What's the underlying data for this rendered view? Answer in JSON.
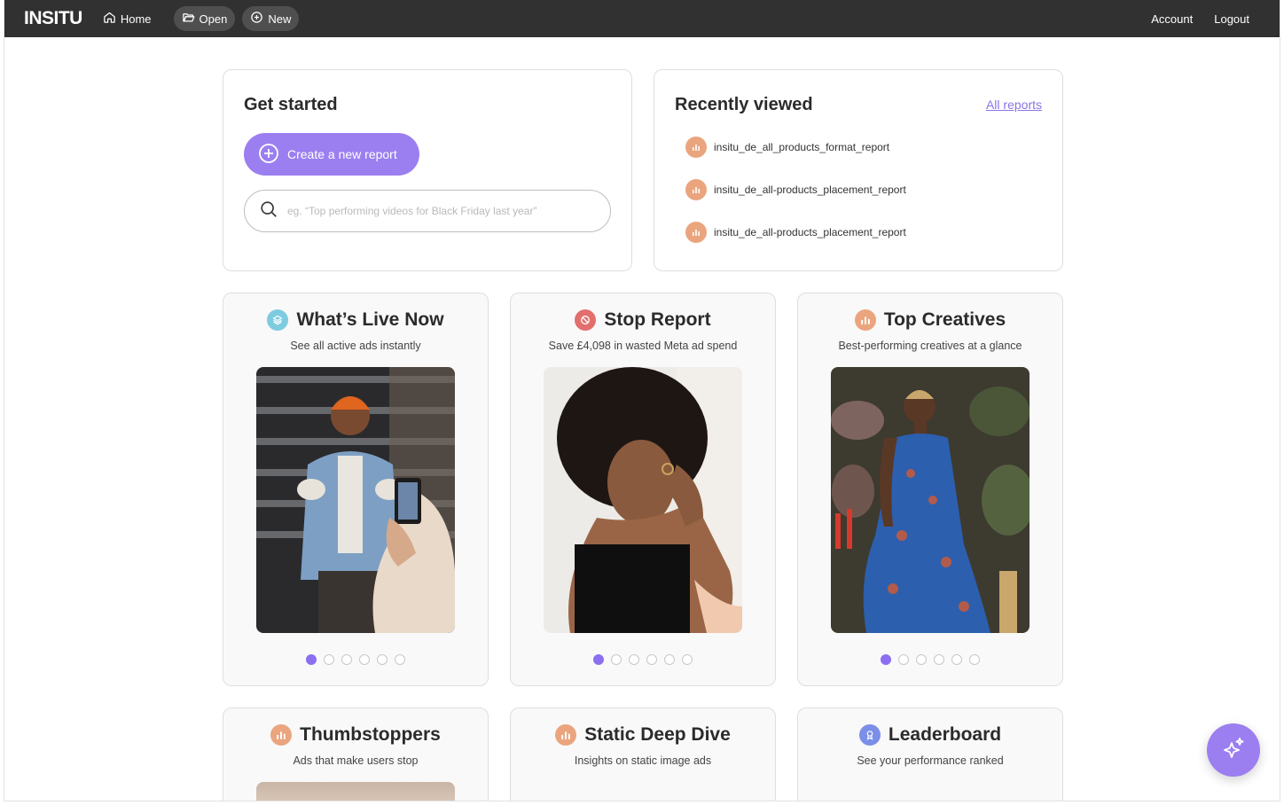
{
  "app": {
    "logo": "INSITU"
  },
  "nav": {
    "home": "Home",
    "open": "Open",
    "new": "New",
    "account": "Account",
    "logout": "Logout"
  },
  "get_started": {
    "title": "Get started",
    "create_label": "Create a new report",
    "search_placeholder": "eg. “Top performing videos for Black Friday last year”",
    "search_value": ""
  },
  "recent": {
    "title": "Recently viewed",
    "all_reports": "All reports",
    "items": [
      "insitu_de_all_products_format_report",
      "insitu_de_all-products_placement_report",
      "insitu_de_all-products_placement_report"
    ]
  },
  "cards": [
    {
      "title": "What’s Live Now",
      "subtitle": "See all active ads instantly",
      "icon": "layers-icon",
      "icon_color": "#7ecbe0",
      "slides": 6,
      "active_slide": 1
    },
    {
      "title": "Stop Report",
      "subtitle": "Save £4,098 in wasted Meta ad spend",
      "icon": "stop-icon",
      "icon_color": "#e36e6e",
      "slides": 6,
      "active_slide": 1
    },
    {
      "title": "Top Creatives",
      "subtitle": "Best-performing creatives at a glance",
      "icon": "bar-chart-icon",
      "icon_color": "#eaa57e",
      "slides": 6,
      "active_slide": 1
    },
    {
      "title": "Thumbstoppers",
      "subtitle": "Ads that make users stop",
      "icon": "bar-chart-icon",
      "icon_color": "#eaa57e"
    },
    {
      "title": "Static Deep Dive",
      "subtitle": "Insights on static image ads",
      "icon": "bar-chart-icon",
      "icon_color": "#eaa57e"
    },
    {
      "title": "Leaderboard",
      "subtitle": "See your performance ranked",
      "icon": "award-icon",
      "icon_color": "#7b8fe8"
    }
  ],
  "colors": {
    "accent": "#9b7ff0",
    "topbar": "#313131",
    "link": "#8c73e6"
  }
}
